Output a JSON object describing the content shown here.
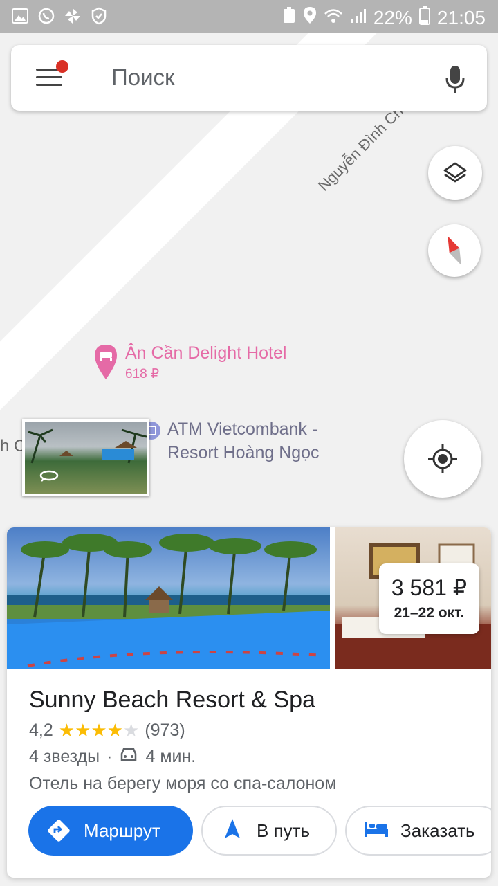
{
  "status_bar": {
    "battery": "22%",
    "time": "21:05"
  },
  "search": {
    "placeholder": "Поиск"
  },
  "map": {
    "road_label": "Nguyễn Đình Chiểu",
    "hotel_poi": {
      "name": "Ân Cần Delight Hotel",
      "price": "618 ₽"
    },
    "atm_poi": {
      "line1": "ATM Vietcombank -",
      "line2": "Resort Hoàng Ngọc"
    },
    "partial_label": "h Club"
  },
  "place_card": {
    "price": "3 581 ₽",
    "dates": "21–22 окт.",
    "title": "Sunny Beach Resort & Spa",
    "rating": "4,2",
    "stars_filled": 4,
    "stars_total": 5,
    "reviews": "(973)",
    "class": "4 звезды",
    "separator": "·",
    "drive_time": "4 мин.",
    "description": "Отель на берегу моря со спа-салоном",
    "buttons": {
      "directions": "Маршрут",
      "start": "В путь",
      "book": "Заказать"
    }
  },
  "colors": {
    "accent": "#1a73e8",
    "hotel_pin": "#e56aa6",
    "star": "#fbbc04"
  }
}
